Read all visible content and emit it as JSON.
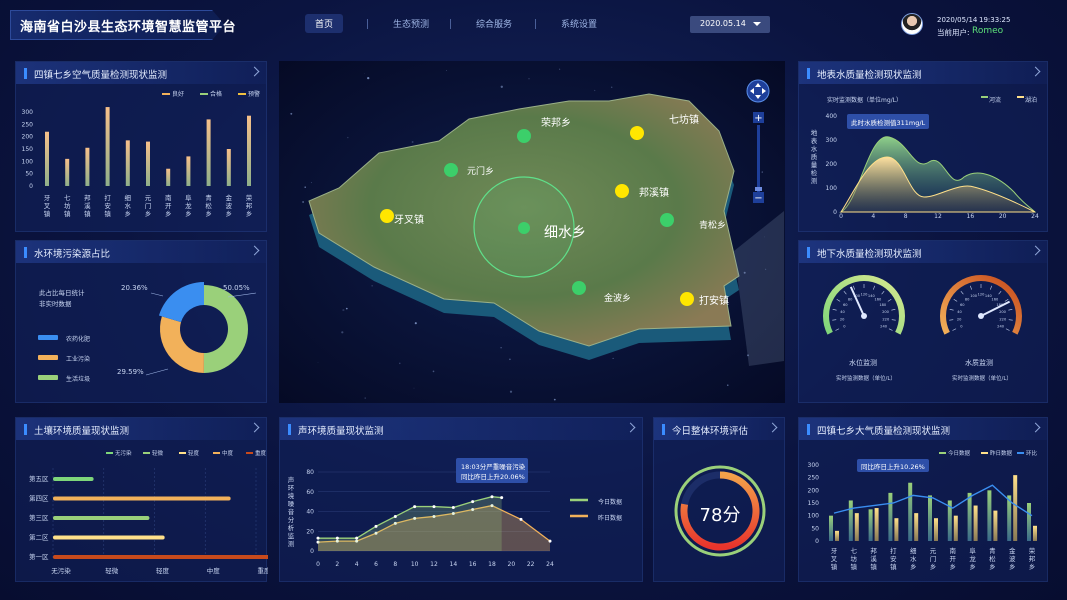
{
  "header": {
    "title": "海南省白沙县生态环境智慧监管平台",
    "nav": [
      "首页",
      "生态预测",
      "综合服务",
      "系统设置"
    ],
    "date": "2020.05.14",
    "user_date": "2020/05/14",
    "user_time": "19:33:25",
    "user_label": "当前用户:",
    "user_name": "Romeo"
  },
  "panels": {
    "air": "四镇七乡空气质量检测现状监测",
    "water_pollution": "水环境污染源占比",
    "soil": "土壤环境质量现状监测",
    "noise": "声环境质量现状监测",
    "overall": "今日整体环境评估",
    "air2": "四镇七乡大气质量检测现状监测",
    "surface": "地表水质量检测现状监测",
    "ground": "地下水质量检测现状监测"
  },
  "towns": [
    "牙叉镇",
    "七坊镇",
    "邦溪镇",
    "打安镇",
    "细水乡",
    "元门乡",
    "南开乡",
    "阜龙乡",
    "青松乡",
    "金波乡",
    "荣邦乡"
  ],
  "air_chart": {
    "legend": [
      "良好",
      "合格",
      "预警"
    ],
    "y_ticks": [
      "300",
      "250",
      "200",
      "150",
      "100",
      "50",
      "0"
    ],
    "values": [
      220,
      110,
      155,
      320,
      185,
      180,
      70,
      120,
      270,
      150,
      285
    ]
  },
  "water_pollution": {
    "note1": "此占比每日统计",
    "note2": "非实时数据",
    "legend": [
      "农药化肥",
      "工业污染",
      "生活垃圾"
    ],
    "pcts": [
      "20.36%",
      "29.59%",
      "50.05%"
    ],
    "values": [
      20.36,
      29.59,
      50.05
    ],
    "colors": [
      "#3a8ef0",
      "#f2b15a",
      "#9ad07a"
    ]
  },
  "soil": {
    "legend": [
      "无污染",
      "轻微",
      "轻度",
      "中度",
      "重度"
    ],
    "rows": [
      "第五区",
      "第四区",
      "第三区",
      "第二区",
      "第一区"
    ],
    "x_ticks": [
      "无污染",
      "轻微",
      "轻度",
      "中度",
      "重度"
    ],
    "values": [
      0.8,
      3.5,
      1.9,
      2.2,
      4.5
    ],
    "colors": [
      "#7ed67a",
      "#f2b15a",
      "#9ad07a",
      "#ffe08a",
      "#c74a1c"
    ]
  },
  "noise": {
    "y_label": "声环境噪音分析监测",
    "tooltip1": "18:03分严重噪音污染",
    "tooltip2": "同比昨日上升20.06%",
    "legend": [
      "今日数据",
      "昨日数据"
    ],
    "x_ticks": [
      "0",
      "2",
      "4",
      "6",
      "8",
      "10",
      "12",
      "14",
      "16",
      "18",
      "20",
      "22",
      "24"
    ],
    "y_ticks": [
      "80",
      "60",
      "40",
      "20",
      "0"
    ],
    "today": [
      [
        0,
        13
      ],
      [
        2,
        13
      ],
      [
        4,
        13
      ],
      [
        6,
        25
      ],
      [
        8,
        35
      ],
      [
        10,
        45
      ],
      [
        12,
        45
      ],
      [
        14,
        44
      ],
      [
        16,
        50
      ],
      [
        18,
        55
      ],
      [
        19,
        54
      ]
    ],
    "yesterday": [
      [
        0,
        9
      ],
      [
        2,
        10
      ],
      [
        4,
        10
      ],
      [
        6,
        18
      ],
      [
        8,
        28
      ],
      [
        10,
        33
      ],
      [
        12,
        35
      ],
      [
        14,
        38
      ],
      [
        16,
        42
      ],
      [
        18,
        46
      ],
      [
        21,
        32
      ],
      [
        24,
        10
      ]
    ]
  },
  "overall": {
    "score": "78分",
    "value": 78
  },
  "air2": {
    "legend": [
      "今日数据",
      "昨日数据",
      "环比"
    ],
    "tooltip": "同比昨日上升10.26%",
    "y_ticks": [
      "300",
      "250",
      "200",
      "150",
      "100",
      "50",
      "0"
    ],
    "today": [
      100,
      160,
      125,
      190,
      230,
      180,
      160,
      190,
      200,
      180,
      150
    ],
    "yesterday": [
      40,
      110,
      130,
      90,
      110,
      90,
      100,
      140,
      120,
      260,
      60
    ],
    "ratio": [
      110,
      130,
      140,
      150,
      180,
      170,
      130,
      180,
      220,
      150,
      100
    ]
  },
  "surface": {
    "unit": "实时监测数据（单位mg/L）",
    "y_label": "地表水质量检测",
    "tooltip": "此时水质检测值311mg/L",
    "legend": [
      "河流",
      "湖泊"
    ],
    "y_ticks": [
      "400",
      "300",
      "200",
      "100",
      "0"
    ],
    "x_ticks": [
      "0",
      "4",
      "8",
      "12",
      "16",
      "20",
      "24"
    ]
  },
  "ground": {
    "g1": "水位监测",
    "g2": "水质监测",
    "unit": "实时监测数据（单位/L）",
    "ticks": [
      "0",
      "20",
      "40",
      "60",
      "80",
      "100",
      "120",
      "140",
      "160",
      "180",
      "200",
      "220",
      "240"
    ],
    "value1": 95,
    "value2": 185
  },
  "map": {
    "center": "细水乡",
    "labels": [
      "荣邦乡",
      "七坊镇",
      "元门乡",
      "邦溪镇",
      "牙叉镇",
      "青松乡",
      "金波乡",
      "打安镇"
    ]
  }
}
